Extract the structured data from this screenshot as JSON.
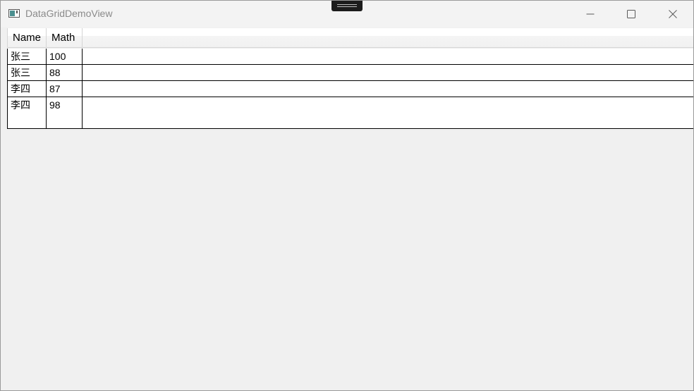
{
  "window": {
    "title": "DataGridDemoView",
    "minimize_icon": "minimize-icon",
    "maximize_icon": "maximize-icon",
    "close_icon": "close-icon"
  },
  "grid": {
    "columns": [
      "Name",
      "Math"
    ],
    "rows": [
      {
        "name": "张三",
        "math": "100"
      },
      {
        "name": "张三",
        "math": "88"
      },
      {
        "name": "李四",
        "math": "87"
      },
      {
        "name": "李四",
        "math": "98"
      },
      {
        "name": "",
        "math": ""
      }
    ]
  },
  "colors": {
    "window_bg": "#f0f0f0",
    "titlebar_bg": "#f3f3f3",
    "title_text": "#8a8a8a",
    "grid_line": "#000000",
    "cell_bg": "#ffffff"
  }
}
